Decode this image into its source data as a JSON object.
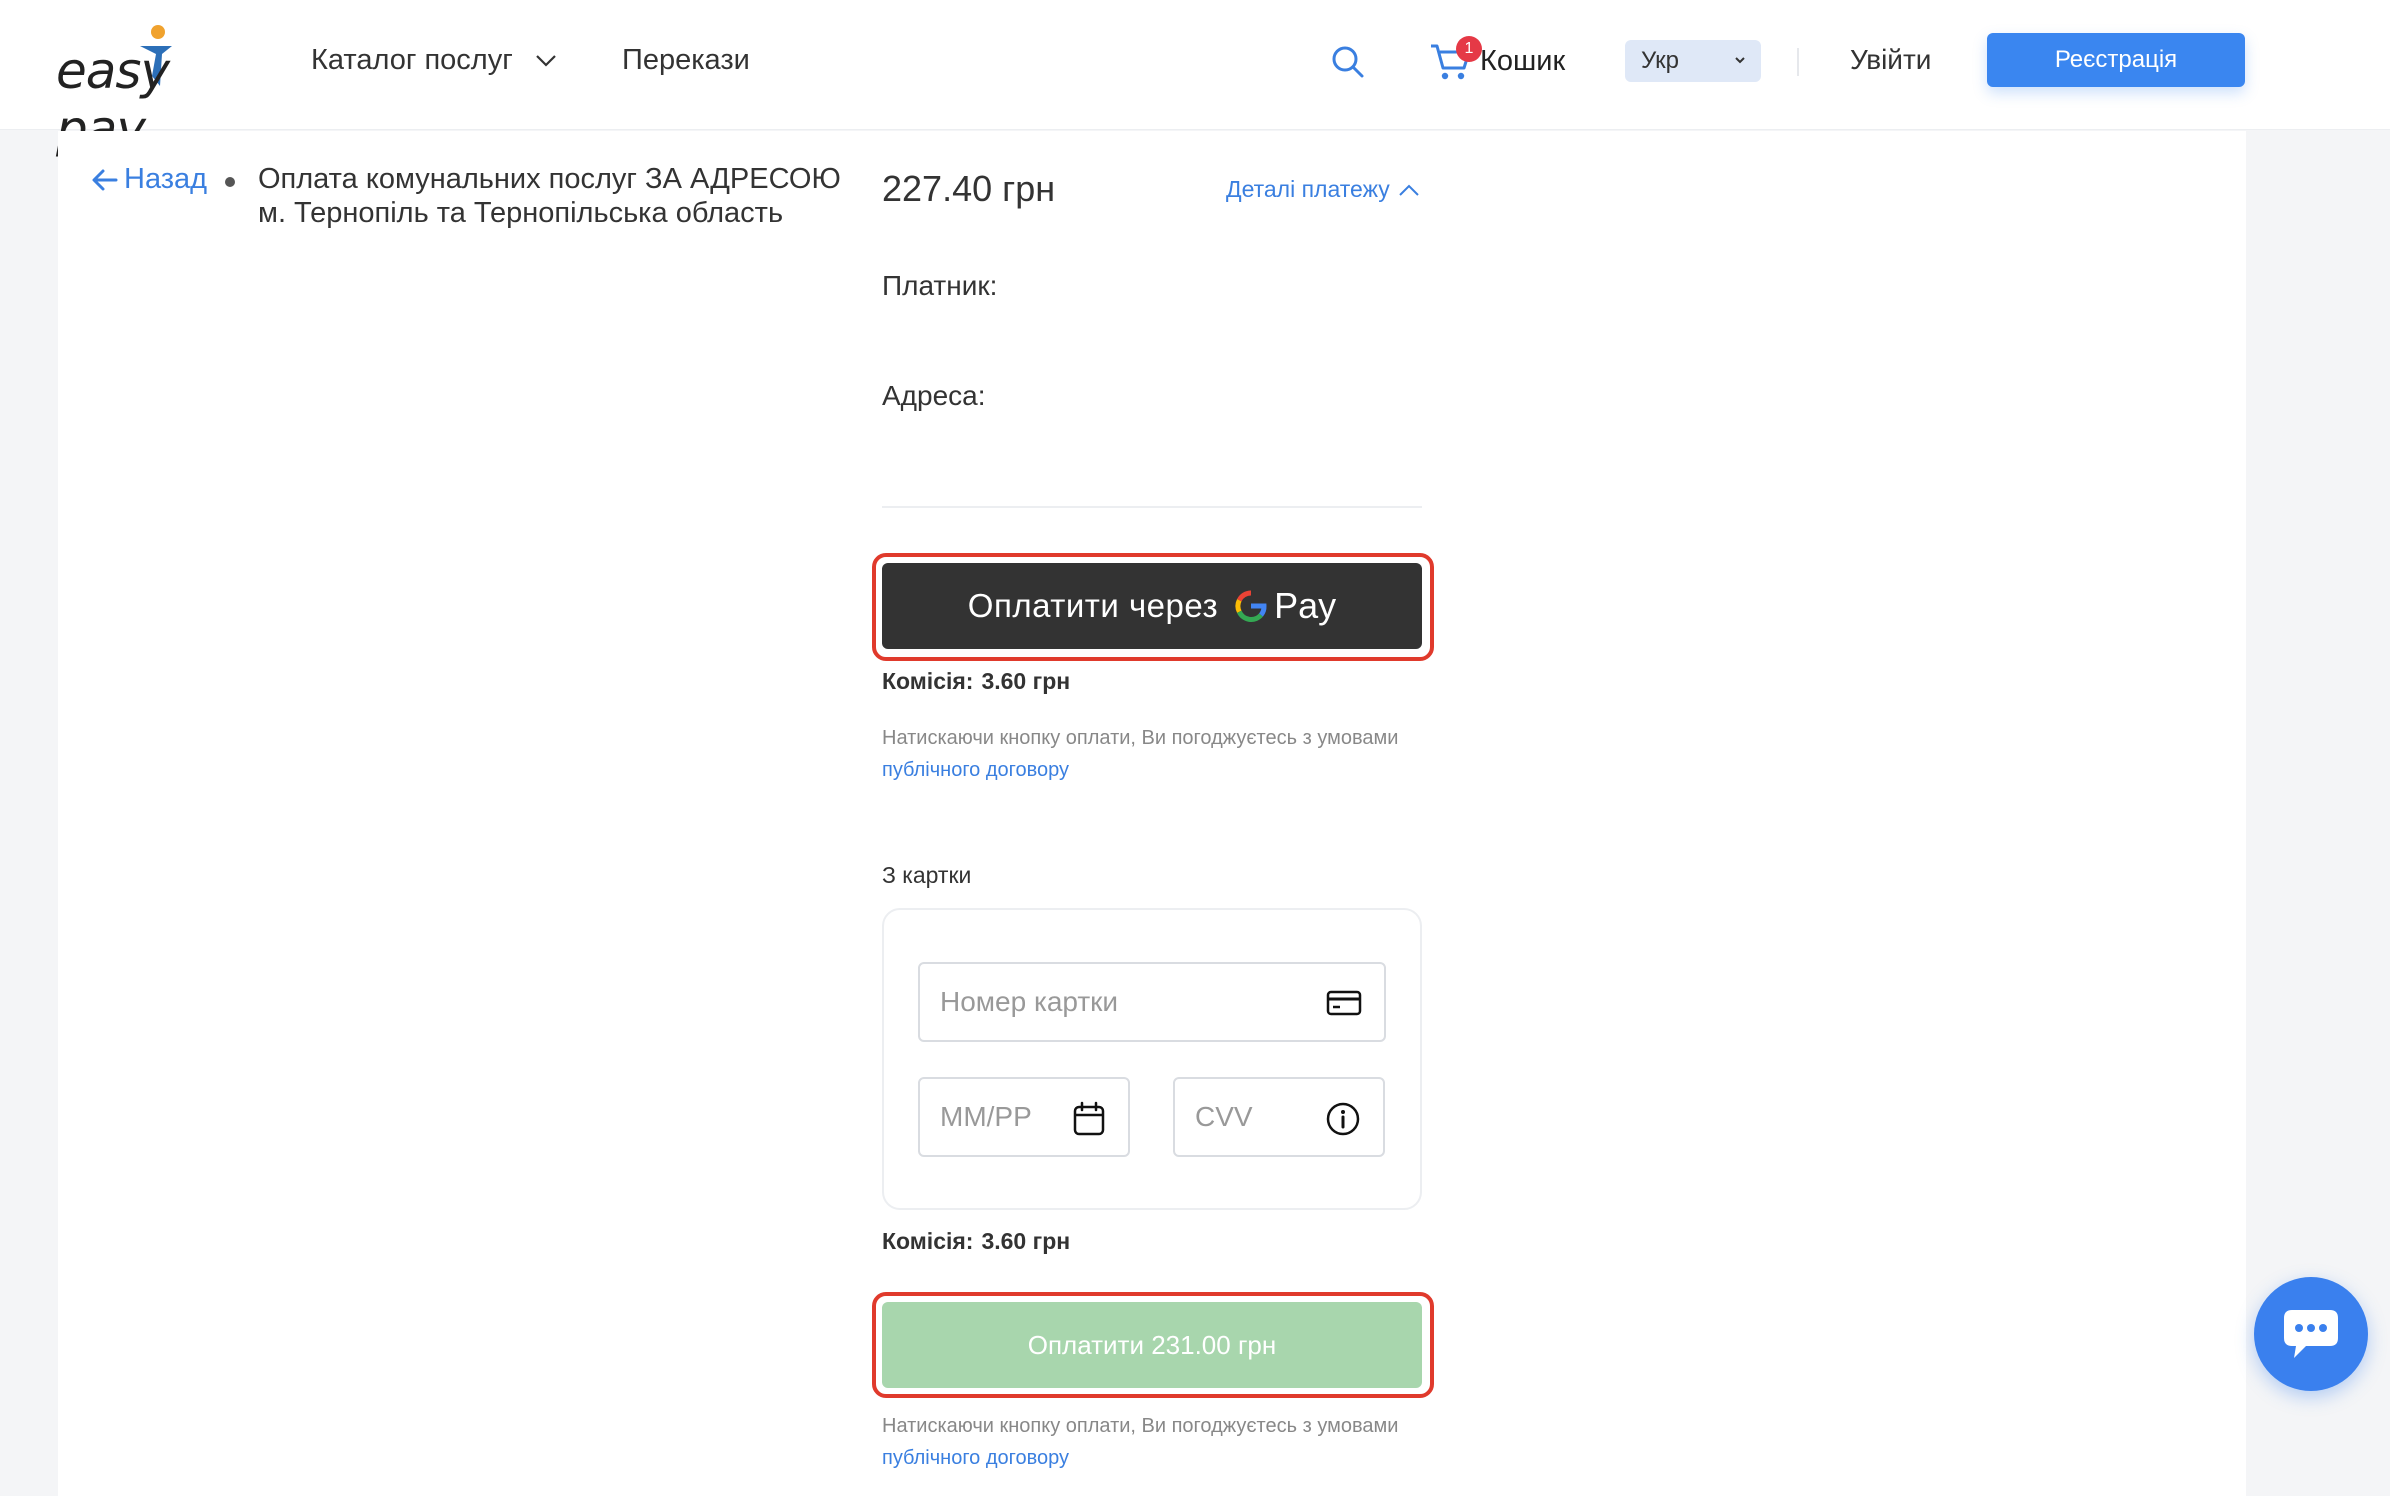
{
  "header": {
    "logo_text": "easy pay",
    "nav": [
      {
        "label": "Каталог послуг"
      },
      {
        "label": "Перекази"
      }
    ],
    "cart": {
      "label": "Кошик",
      "count": "1"
    },
    "language": {
      "selected": "Укр"
    },
    "login_label": "Увійти",
    "register_label": "Реєстрація"
  },
  "breadcrumb": {
    "back_label": "Назад",
    "service_title": "Оплата комунальних послуг ЗА АДРЕСОЮ м. Тернопіль та Тернопільська область"
  },
  "payment": {
    "amount": "227.40 грн",
    "details_label": "Деталі платежу",
    "payer_label": "Платник:",
    "address_label": "Адреса:",
    "gpay": {
      "prefix": "Оплатити через",
      "brand": "Pay"
    },
    "commission": {
      "label": "Комісія:",
      "value": "3.60 грн"
    },
    "agreement": {
      "text": "Натискаючи кнопку оплати, Ви погоджуєтесь з умовами",
      "link": "публічного договору"
    },
    "from_card_label": "З картки",
    "card_number_placeholder": "Номер картки",
    "expiry_placeholder": "ММ/РР",
    "cvv_placeholder": "CVV",
    "pay_button_label": "Оплатити 231.00 грн"
  },
  "colors": {
    "accent": "#3a86f0",
    "highlight": "#e03a2c",
    "pay_button": "#a8d6ad",
    "gpay_button": "#333333"
  },
  "icons": [
    "search-icon",
    "cart-icon",
    "chevron-down-icon",
    "arrow-left-icon",
    "chevron-up-icon",
    "credit-card-icon",
    "calendar-icon",
    "info-icon",
    "chat-icon",
    "google-g-icon"
  ]
}
